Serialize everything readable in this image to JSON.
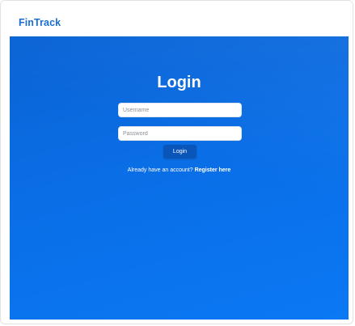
{
  "header": {
    "brand": "FinTrack"
  },
  "login": {
    "title": "Login",
    "username_placeholder": "Username",
    "password_placeholder": "Password",
    "username_value": "",
    "password_value": "",
    "button_label": "Login",
    "register_prompt": "Already have an account?",
    "register_link_label": "Register here"
  },
  "colors": {
    "brand": "#1a6fd1",
    "hero_background": "#0a6ee6",
    "button_background": "#0a56b8"
  }
}
